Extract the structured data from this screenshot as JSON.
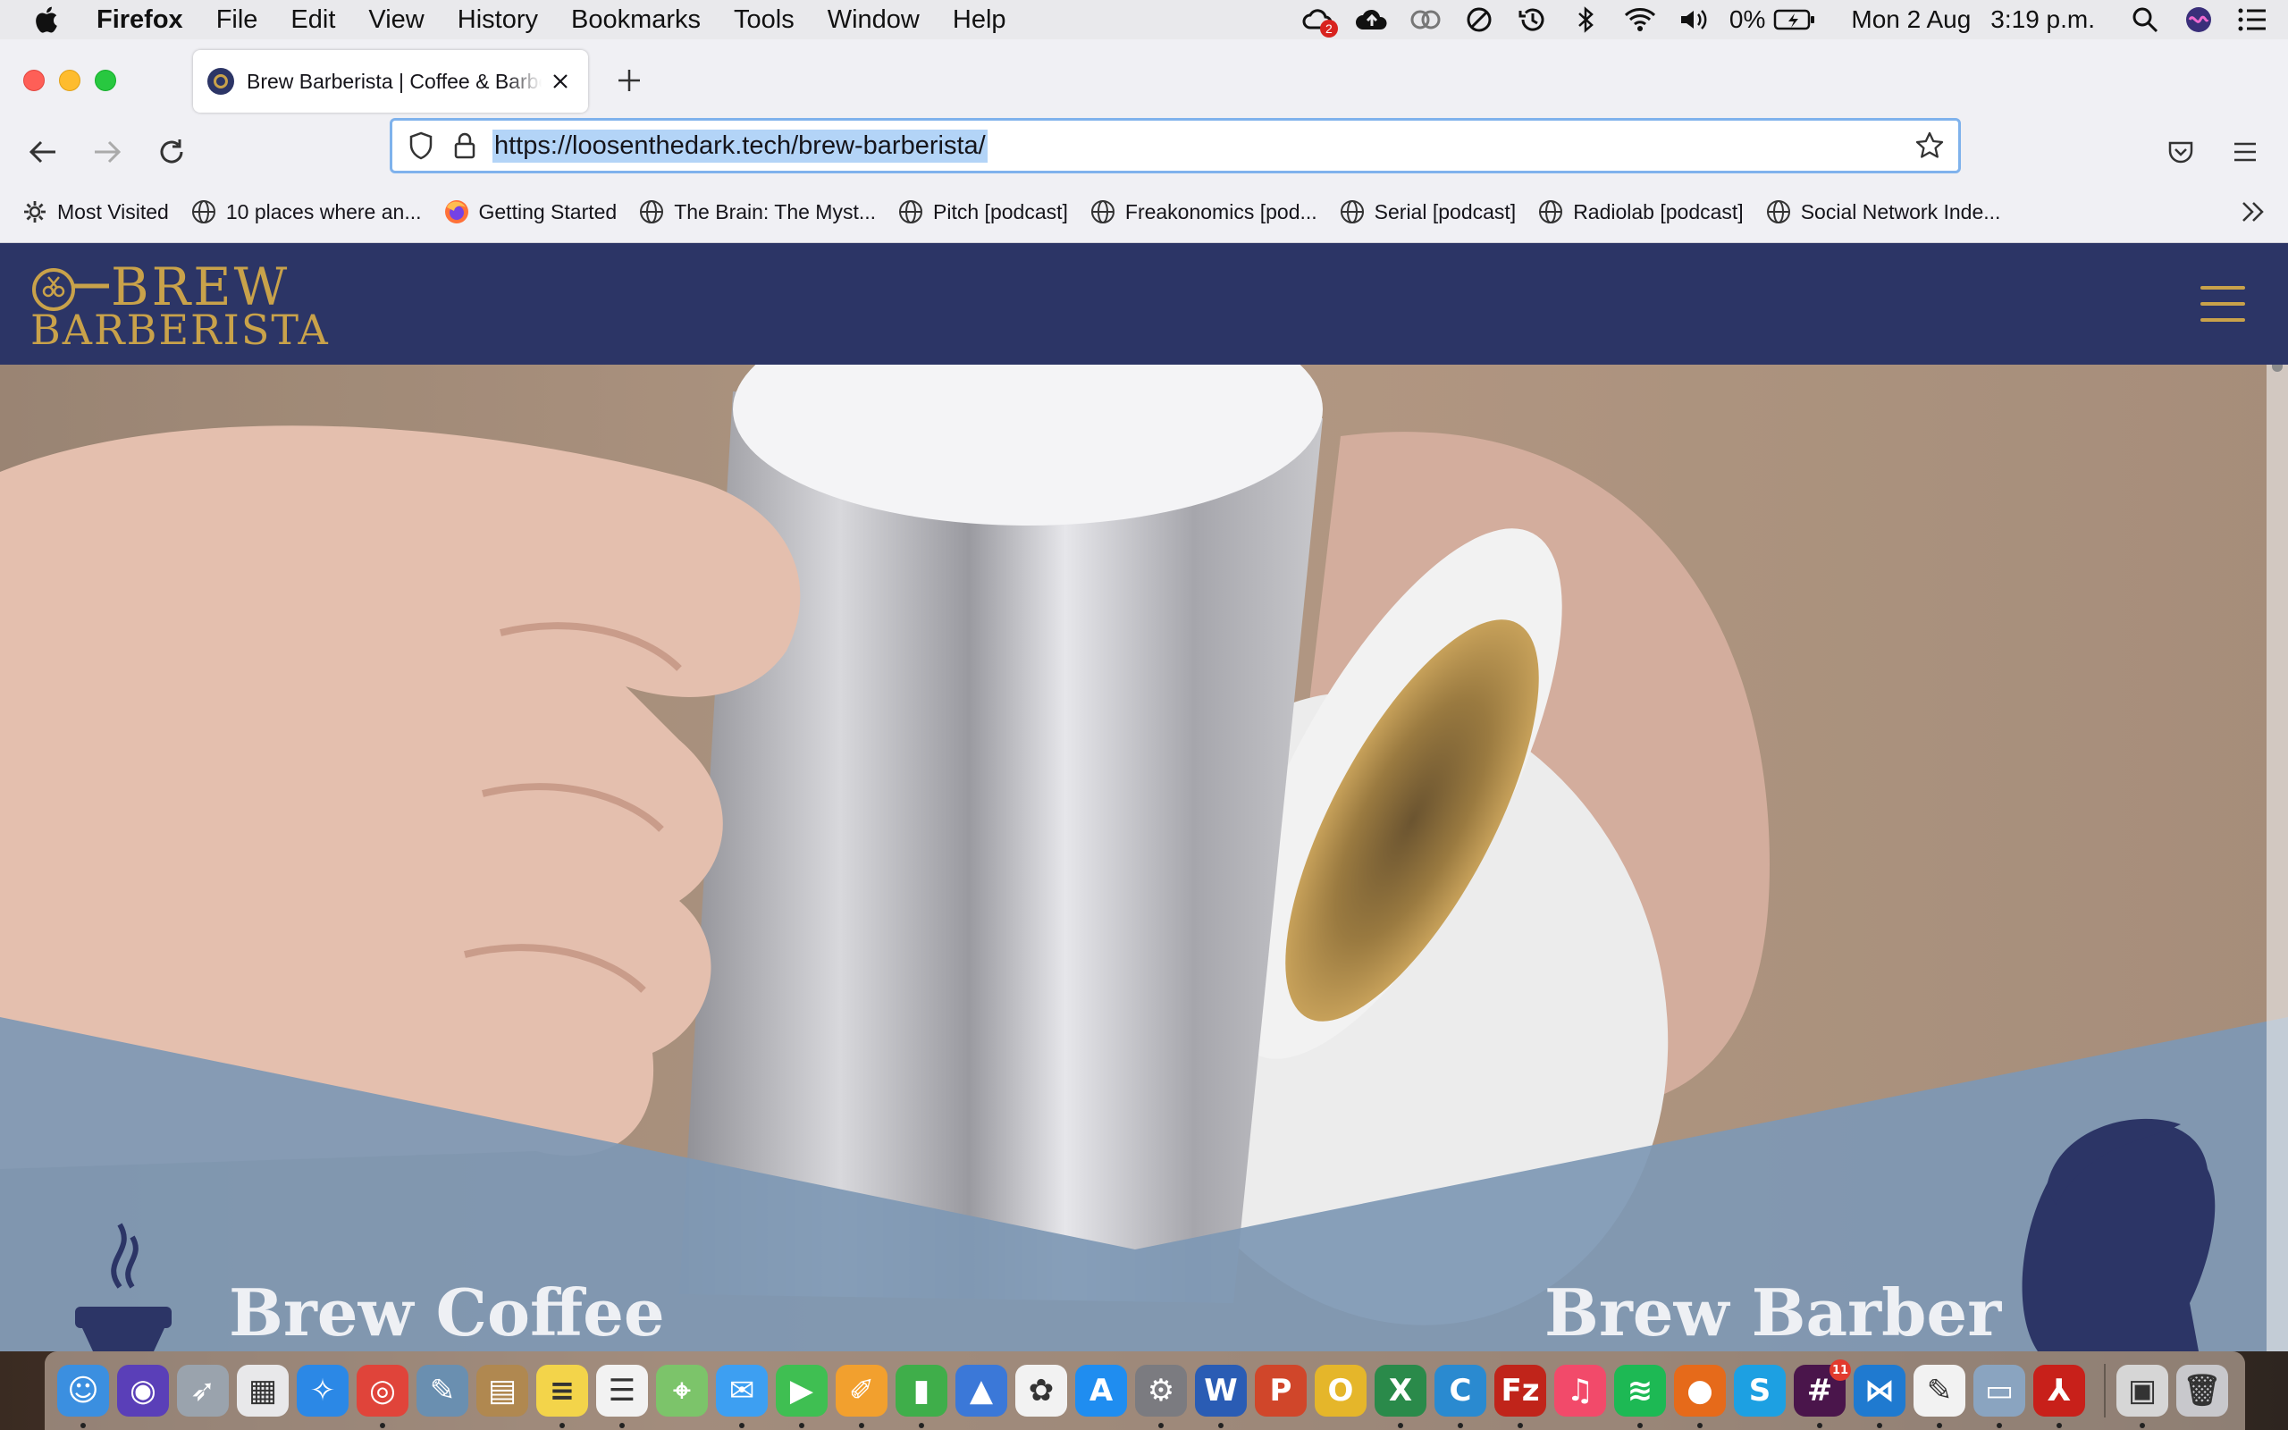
{
  "menubar": {
    "app_name": "Firefox",
    "items": [
      "File",
      "Edit",
      "View",
      "History",
      "Bookmarks",
      "Tools",
      "Window",
      "Help"
    ],
    "battery_text": "0%",
    "date": "Mon 2 Aug",
    "time": "3:19 p.m.",
    "cloud_badge": "2"
  },
  "browser": {
    "tab_title": "Brew Barberista | Coffee & Barber",
    "url": "https://loosenthedark.tech/brew-barberista/",
    "bookmarks": [
      {
        "label": "Most Visited",
        "icon": "gear-icon"
      },
      {
        "label": "10 places where an...",
        "icon": "globe-icon"
      },
      {
        "label": "Getting Started",
        "icon": "firefox-icon"
      },
      {
        "label": "The Brain: The Myst...",
        "icon": "globe-icon"
      },
      {
        "label": "Pitch [podcast]",
        "icon": "globe-icon"
      },
      {
        "label": "Freakonomics [pod...",
        "icon": "globe-icon"
      },
      {
        "label": "Serial [podcast]",
        "icon": "globe-icon"
      },
      {
        "label": "Radiolab [podcast]",
        "icon": "globe-icon"
      },
      {
        "label": "Social Network Inde...",
        "icon": "globe-icon"
      }
    ]
  },
  "site": {
    "logo_top": "BREW",
    "logo_bottom": "BARBERISTA",
    "coffee_heading": "Brew Coffee",
    "barber_heading": "Brew Barber",
    "colors": {
      "navy": "#2c3566",
      "gold": "#c9a24a",
      "panel_blue": "#7e98b4"
    }
  },
  "dock": {
    "slack_badge": "11",
    "apps": [
      {
        "name": "finder",
        "glyph": "☺",
        "bg": "#3b8fe0"
      },
      {
        "name": "siri",
        "glyph": "◉",
        "bg": "#5a3fb8"
      },
      {
        "name": "launchpad",
        "glyph": "➶",
        "bg": "#9aa3ad"
      },
      {
        "name": "launchpad-grid",
        "glyph": "▦",
        "bg": "#e8e8ea"
      },
      {
        "name": "safari",
        "glyph": "✧",
        "bg": "#2b88e6"
      },
      {
        "name": "chrome",
        "glyph": "◎",
        "bg": "#e0443a"
      },
      {
        "name": "preview",
        "glyph": "✎",
        "bg": "#6a8fb0"
      },
      {
        "name": "notebook",
        "glyph": "▤",
        "bg": "#b08850"
      },
      {
        "name": "notes",
        "glyph": "≡",
        "bg": "#f3d44a"
      },
      {
        "name": "reminders",
        "glyph": "☰",
        "bg": "#f2f2f2"
      },
      {
        "name": "maps",
        "glyph": "⌖",
        "bg": "#7cc46a"
      },
      {
        "name": "messages",
        "glyph": "✉",
        "bg": "#3d9ff2"
      },
      {
        "name": "facetime",
        "glyph": "▶",
        "bg": "#3fbf52"
      },
      {
        "name": "pages",
        "glyph": "✐",
        "bg": "#f2a02e"
      },
      {
        "name": "numbers",
        "glyph": "▮",
        "bg": "#3fae4a"
      },
      {
        "name": "keynote",
        "glyph": "▲",
        "bg": "#3b78d8"
      },
      {
        "name": "photos",
        "glyph": "✿",
        "bg": "#f2f2f2"
      },
      {
        "name": "app-store",
        "glyph": "A",
        "bg": "#1f8df0"
      },
      {
        "name": "system-preferences",
        "glyph": "⚙",
        "bg": "#7b7b80"
      },
      {
        "name": "word",
        "glyph": "W",
        "bg": "#2a5cb4"
      },
      {
        "name": "powerpoint",
        "glyph": "P",
        "bg": "#d0462a"
      },
      {
        "name": "o-app",
        "glyph": "O",
        "bg": "#e5b62a"
      },
      {
        "name": "excel",
        "glyph": "X",
        "bg": "#2a8a4a"
      },
      {
        "name": "c-app",
        "glyph": "C",
        "bg": "#2a8ad0"
      },
      {
        "name": "filezilla",
        "glyph": "Fz",
        "bg": "#c0241a"
      },
      {
        "name": "music",
        "glyph": "♫",
        "bg": "#f24a6a"
      },
      {
        "name": "spotify",
        "glyph": "≋",
        "bg": "#1db954"
      },
      {
        "name": "firefox",
        "glyph": "●",
        "bg": "#e66a1a"
      },
      {
        "name": "skype",
        "glyph": "S",
        "bg": "#1da0e2"
      },
      {
        "name": "slack",
        "glyph": "#",
        "bg": "#4a154b"
      },
      {
        "name": "vscode",
        "glyph": "⋈",
        "bg": "#1f7ad0"
      },
      {
        "name": "textedit",
        "glyph": "✎",
        "bg": "#f2f2f2"
      },
      {
        "name": "image-capture",
        "glyph": "▭",
        "bg": "#8aa4c0"
      },
      {
        "name": "acrobat",
        "glyph": "⅄",
        "bg": "#c8201a"
      },
      {
        "name": "screen-sharing",
        "glyph": "▣",
        "bg": "#d6d6d6"
      },
      {
        "name": "trash",
        "glyph": "🗑",
        "bg": "#c8c8cc"
      }
    ]
  }
}
